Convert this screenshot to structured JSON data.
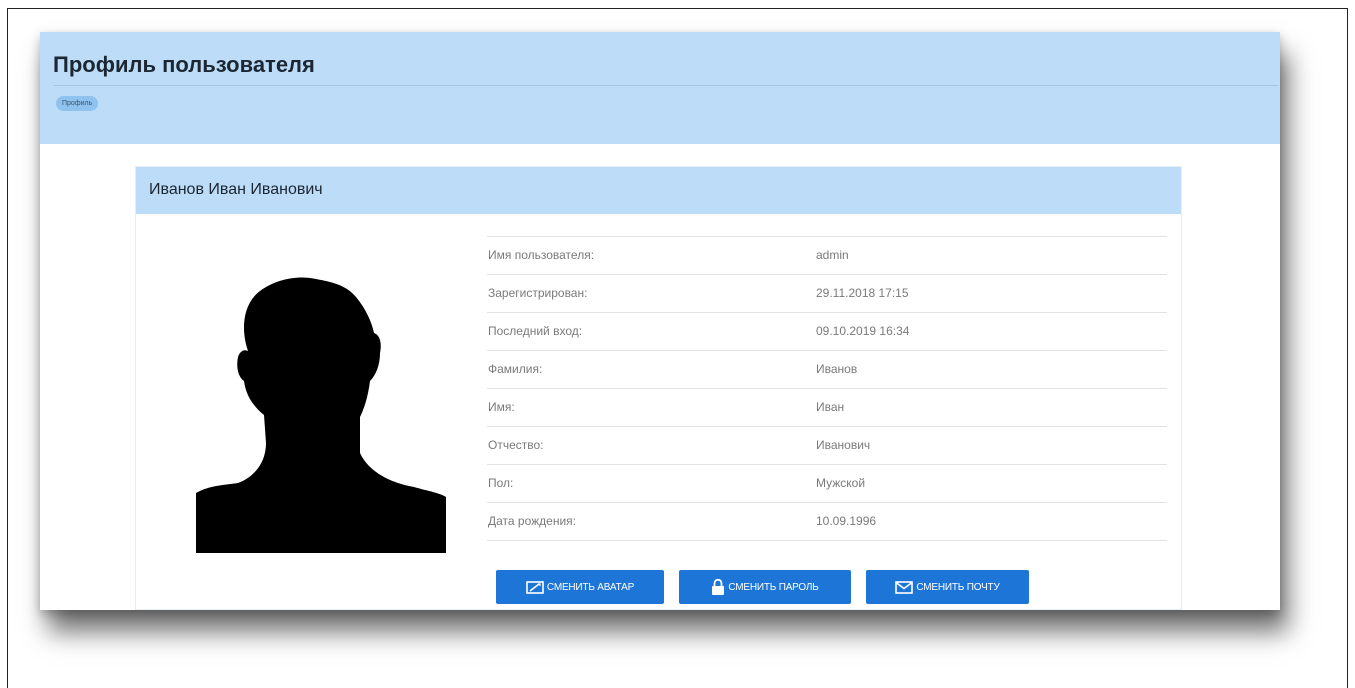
{
  "header": {
    "title": "Профиль пользователя",
    "breadcrumb": "Профиль"
  },
  "card": {
    "title": "Иванов Иван Иванович",
    "avatar_icon": "user-silhouette-icon"
  },
  "profile": {
    "rows": [
      {
        "label": "Имя пользователя:",
        "value": "admin"
      },
      {
        "label": "Зарегистрирован:",
        "value": "29.11.2018 17:15"
      },
      {
        "label": "Последний вход:",
        "value": "09.10.2019 16:34"
      },
      {
        "label": "Фамилия:",
        "value": "Иванов"
      },
      {
        "label": "Имя:",
        "value": "Иван"
      },
      {
        "label": "Отчество:",
        "value": "Иванович"
      },
      {
        "label": "Пол:",
        "value": "Мужской"
      },
      {
        "label": "Дата рождения:",
        "value": "10.09.1996"
      }
    ]
  },
  "actions": {
    "change_avatar": {
      "label": "СМЕНИТЬ АВАТАР",
      "icon": "picture-icon"
    },
    "change_password": {
      "label": "СМЕНИТЬ ПАРОЛЬ",
      "icon": "lock-icon"
    },
    "change_email": {
      "label": "СМЕНИТЬ ПОЧТУ",
      "icon": "envelope-icon"
    }
  },
  "colors": {
    "header_bg": "#bcdcf7",
    "button_bg": "#1d75d8",
    "breadcrumb_bg": "#8fc2ee"
  }
}
